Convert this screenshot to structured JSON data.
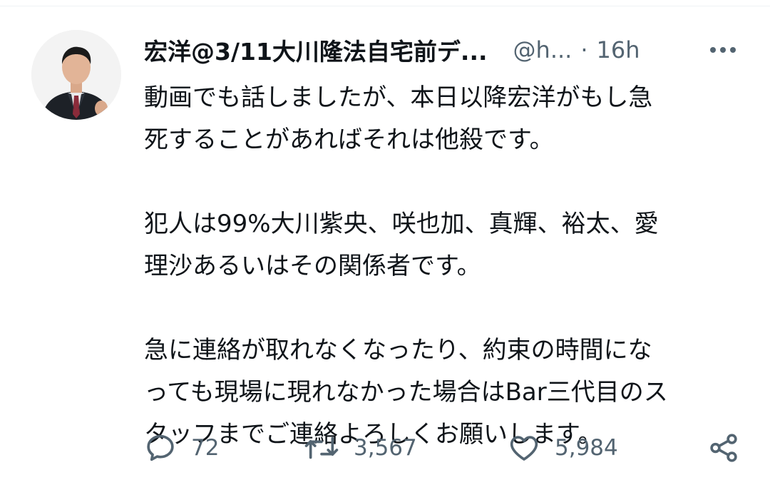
{
  "author": {
    "display_name": "宏洋@3/11大川隆法自宅前デ...",
    "handle": "@h...",
    "separator": "·",
    "time": "16h"
  },
  "tweet": {
    "paragraphs": [
      {
        "lines": [
          "動画でも話しましたが、本日以降宏洋がもし急",
          "死することがあればそれは他殺です。"
        ]
      },
      {
        "lines": [
          "犯人は99%大川紫央、咲也加、真輝、裕太、愛",
          "理沙あるいはその関係者です。"
        ]
      },
      {
        "lines": [
          "急に連絡が取れなくなったり、約束の時間にな",
          "っても現場に現れなかった場合はBar三代目のス",
          "タッフまでご連絡よろしくお願いします。"
        ]
      }
    ]
  },
  "actions": {
    "replies": "72",
    "retweets": "3,567",
    "likes": "5,984"
  },
  "icons": {
    "reply": "speech-bubble-icon",
    "retweet": "retweet-arrows-icon",
    "like": "heart-outline-icon",
    "share": "share-nodes-icon",
    "more": "more-horizontal-icon"
  },
  "colors": {
    "text_primary": "#0f1419",
    "text_secondary": "#536471"
  }
}
